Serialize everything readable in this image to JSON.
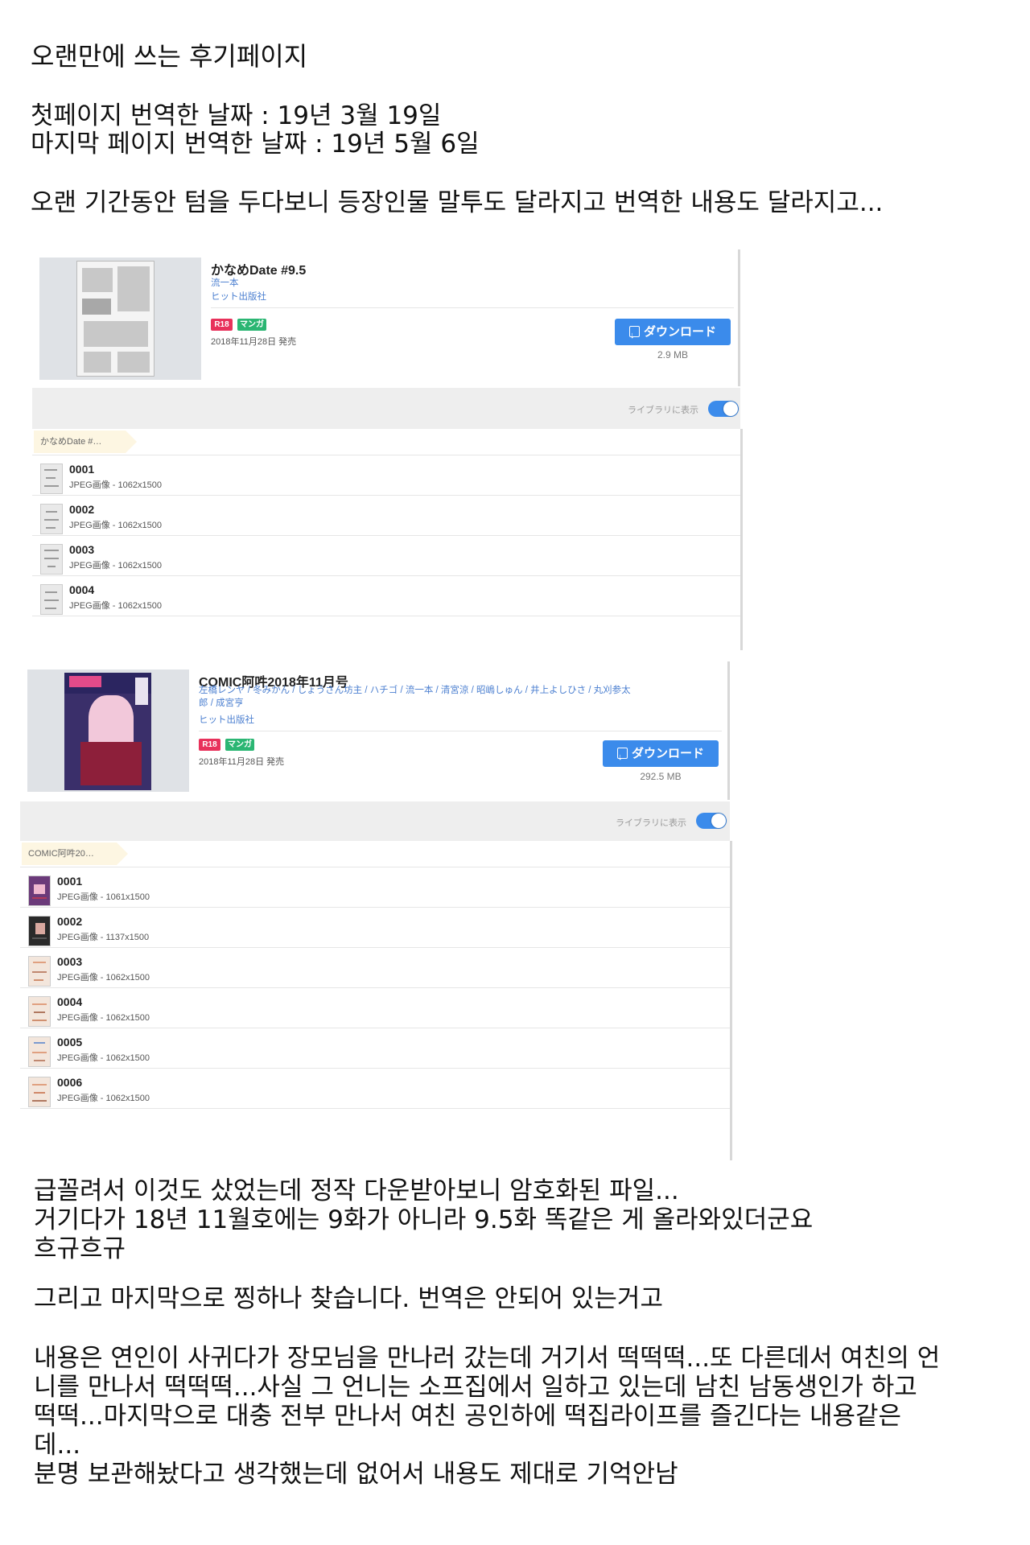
{
  "intro": {
    "heading": "오랜만에 쓰는 후기페이지",
    "line1": "첫페이지 번역한 날짜 : 19년 3월 19일",
    "line2": "마지막 페이지 번역한 날짜 : 19년 5월 6일",
    "line3": "오랜 기간동안 텀을 두다보니 등장인물 말투도 달라지고 번역한 내용도 달라지고..."
  },
  "card1": {
    "title": "かなめDate #9.5",
    "author": "流一本",
    "publisher": "ヒット出版社",
    "badges": [
      "R18",
      "マンガ"
    ],
    "date": "2018年11月28日 発売",
    "download_label": "ダウンロード",
    "size": "2.9 MB",
    "library_label": "ライブラリに表示",
    "breadcrumb": "かなめDate #…",
    "files": [
      {
        "num": "0001",
        "meta": "JPEG画像 - 1062x1500"
      },
      {
        "num": "0002",
        "meta": "JPEG画像 - 1062x1500"
      },
      {
        "num": "0003",
        "meta": "JPEG画像 - 1062x1500"
      },
      {
        "num": "0004",
        "meta": "JPEG画像 - 1062x1500"
      }
    ]
  },
  "card2": {
    "title": "COMIC阿吽2018年11月号",
    "authors": "左橋レンヤ / 冬みかん / しょうさん坊主 / ハチゴ / 流一本 / 清宮涼 / 昭嶋しゅん / 井上よしひさ / 丸刈参太郎 / 成宮亨",
    "publisher": "ヒット出版社",
    "badges": [
      "R18",
      "マンガ"
    ],
    "date": "2018年11月28日 発売",
    "download_label": "ダウンロード",
    "size": "292.5 MB",
    "library_label": "ライブラリに表示",
    "breadcrumb": "COMIC阿吽20…",
    "files": [
      {
        "num": "0001",
        "meta": "JPEG画像 - 1061x1500"
      },
      {
        "num": "0002",
        "meta": "JPEG画像 - 1137x1500"
      },
      {
        "num": "0003",
        "meta": "JPEG画像 - 1062x1500"
      },
      {
        "num": "0004",
        "meta": "JPEG画像 - 1062x1500"
      },
      {
        "num": "0005",
        "meta": "JPEG画像 - 1062x1500"
      },
      {
        "num": "0006",
        "meta": "JPEG画像 - 1062x1500"
      }
    ]
  },
  "outro": {
    "p1_l1": "급꼴려서 이것도 샀었는데 정작 다운받아보니 암호화된 파일...",
    "p1_l2": "거기다가 18년 11월호에는 9화가 아니라 9.5화 똑같은 게 올라와있더군요",
    "p1_l3": "흐규흐규",
    "p2": "그리고 마지막으로 찡하나 찾습니다. 번역은 안되어 있는거고",
    "p3_l1": "내용은 연인이 사귀다가 장모님을 만나러 갔는데 거기서 떡떡떡...또 다른데서 여친의 언",
    "p3_l2": "니를 만나서 떡떡떡...사실 그 언니는 소프집에서 일하고 있는데 남친 남동생인가 하고",
    "p3_l3": "떡떡...마지막으로 대충 전부 만나서 여친 공인하에 떡집라이프를 즐긴다는 내용같은",
    "p3_l4": "데...",
    "p3_l5": "분명 보관해놨다고 생각했는데 없어서 내용도 제대로 기억안남"
  },
  "colors": {
    "accent": "#3b8beb",
    "r18": "#e8315b",
    "manga": "#2bb673",
    "link": "#4b7fd0"
  }
}
